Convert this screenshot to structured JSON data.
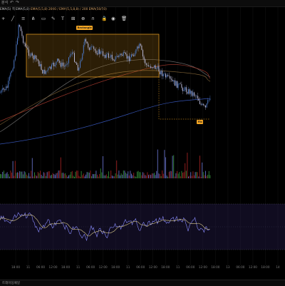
{
  "topbar": {
    "menu_text": "분석",
    "undo_icon": "↶",
    "redo_icon": "↷"
  },
  "legend": {
    "prefix": "EMA(5) 적 EMA(5,8) ",
    "series_text": "EMA(5,5,8) 2000 / EMA(5,5,8,8) / 200 EMA(50/50)"
  },
  "draw_tools": [
    {
      "name": "crosshair-icon",
      "glyph": "+"
    },
    {
      "name": "trendline-icon",
      "glyph": "╱"
    },
    {
      "name": "hline-icon",
      "glyph": "≡"
    },
    {
      "name": "fib-icon",
      "glyph": "⋔"
    },
    {
      "name": "rect-icon",
      "glyph": "▭"
    },
    {
      "name": "brush-icon",
      "glyph": "✎"
    },
    {
      "name": "text-icon",
      "glyph": "T"
    },
    {
      "name": "measure-icon",
      "glyph": "⊞"
    },
    {
      "name": "zoom-icon",
      "glyph": "⊕"
    },
    {
      "name": "magnet-icon",
      "glyph": "∩"
    },
    {
      "name": "lock-icon",
      "glyph": "🔒"
    },
    {
      "name": "eye-icon",
      "glyph": "◉"
    },
    {
      "name": "trash-icon",
      "glyph": "🗑"
    }
  ],
  "badges": {
    "top": "Rectangle",
    "bottom": "Fib"
  },
  "time_axis": [
    "18:00",
    "11",
    "06:00",
    "12:00",
    "18:00",
    "11",
    "06:00",
    "12:00",
    "18:00",
    "11",
    "06:00",
    "12:00",
    "18:00",
    "11",
    "06:00",
    "12:00",
    "18:00",
    "13",
    "06:00",
    "12:00",
    "18:00",
    "14"
  ],
  "indicator_label": "",
  "bottom_text": "트레이딩패널",
  "colors": {
    "background": "#000000",
    "candle_up": "#4c78c6",
    "candle_down": "#b8b8d8",
    "rect_fill": "#f5a623",
    "badge": "#f5a623",
    "volume_up": "#2e7d32",
    "volume_down": "#8e1d1d",
    "volume_neutral": "#5a63b0",
    "rsi_line": "#8a8cff",
    "rsi_ma": "#d9c98a",
    "ma_red": "#a33a2d",
    "ma_brown": "#8a6a3a",
    "ma_gray": "#7d7d7d",
    "ma_blue": "#3b5cc6"
  }
}
